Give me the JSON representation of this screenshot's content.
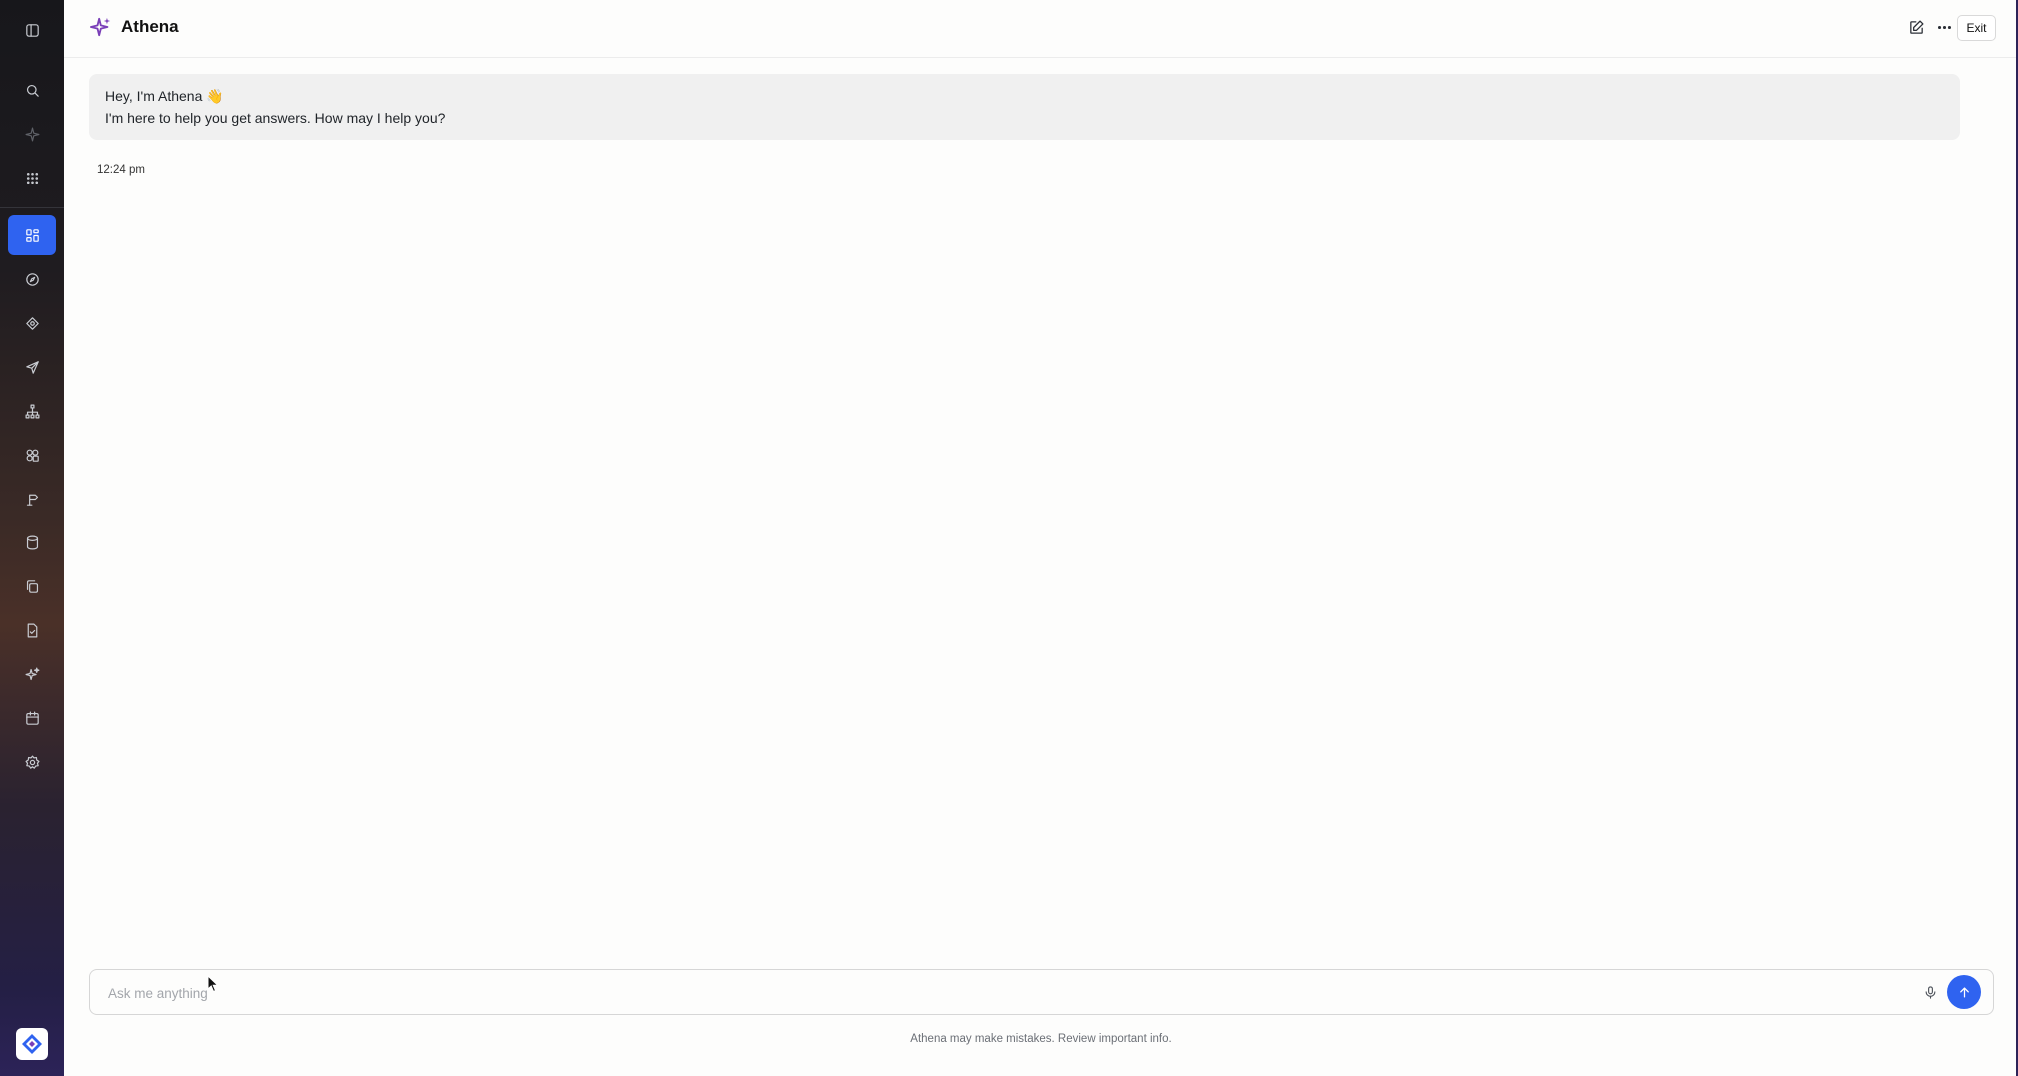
{
  "app": {
    "title": "Athena"
  },
  "sidebar": {
    "items": [
      {
        "icon": "panel-toggle-icon"
      },
      {
        "icon": "search-icon"
      },
      {
        "icon": "sparkle-icon"
      },
      {
        "icon": "apps-grid-icon"
      },
      {
        "icon": "dashboard-icon"
      },
      {
        "icon": "compass-icon"
      },
      {
        "icon": "target-icon"
      },
      {
        "icon": "send-icon"
      },
      {
        "icon": "hierarchy-icon"
      },
      {
        "icon": "components-icon"
      },
      {
        "icon": "signpost-icon"
      },
      {
        "icon": "database-icon"
      },
      {
        "icon": "copy-files-icon"
      },
      {
        "icon": "document-check-icon"
      },
      {
        "icon": "sparkles-icon"
      },
      {
        "icon": "calendar-icon"
      },
      {
        "icon": "settings-icon"
      }
    ]
  },
  "header": {
    "title": "Athena",
    "exit_label": "Exit"
  },
  "chat": {
    "messages": [
      {
        "line1": "Hey, I'm Athena 👋",
        "line2": "I'm here to help you get answers. How may I help you?",
        "time": "12:24 pm"
      }
    ]
  },
  "composer": {
    "placeholder": "Ask me anything",
    "value": ""
  },
  "footer": {
    "disclaimer": "Athena may make mistakes. Review important info."
  },
  "colors": {
    "accent": "#2f63f0",
    "logo_purple": "#7a3fb8"
  }
}
